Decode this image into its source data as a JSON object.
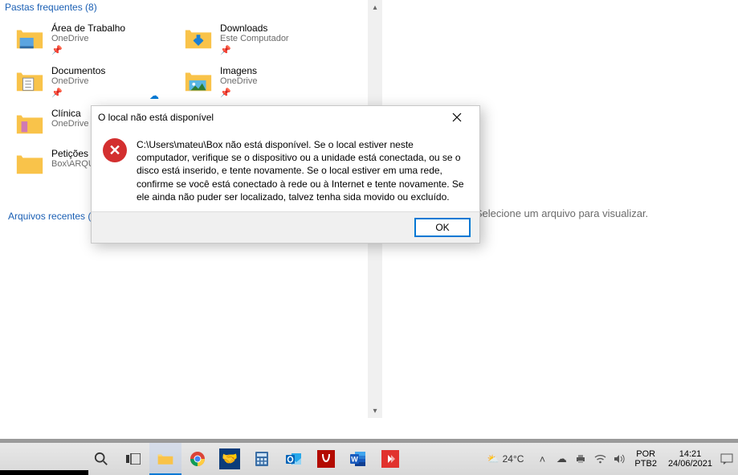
{
  "explorer": {
    "section_frequent": "Pastas frequentes (8)",
    "section_recent": "Arquivos recentes (2",
    "folders": [
      {
        "name": "Área de Trabalho",
        "sub": "OneDrive",
        "icon": "desktop",
        "pinned": true
      },
      {
        "name": "Downloads",
        "sub": "Este Computador",
        "icon": "downloads",
        "pinned": true
      },
      {
        "name": "Documentos",
        "sub": "OneDrive",
        "icon": "documents",
        "pinned": true,
        "cloud": true
      },
      {
        "name": "Imagens",
        "sub": "OneDrive",
        "icon": "pictures",
        "pinned": true,
        "cloud": true
      },
      {
        "name": "Clínica",
        "sub": "OneDrive",
        "icon": "folder",
        "pinned": false
      },
      {
        "name": "Petições",
        "sub": "Box\\ARQUIV",
        "icon": "folder",
        "pinned": false
      }
    ]
  },
  "preview": {
    "placeholder": "Selecione um arquivo para visualizar."
  },
  "dialog": {
    "title": "O local não está disponível",
    "message": "C:\\Users\\mateu\\Box não está disponível. Se o local estiver neste computador, verifique se o dispositivo ou a unidade está conectada, ou se o disco está inserido, e tente novamente. Se o local estiver em uma rede, confirme se você está conectado à rede ou à Internet e tente novamente. Se ele ainda não puder ser localizado, talvez tenha sida movido ou excluído.",
    "ok": "OK"
  },
  "taskbar": {
    "weather_temp": "24°C",
    "lang1": "POR",
    "lang2": "PTB2",
    "time": "14:21",
    "date": "24/06/2021"
  }
}
